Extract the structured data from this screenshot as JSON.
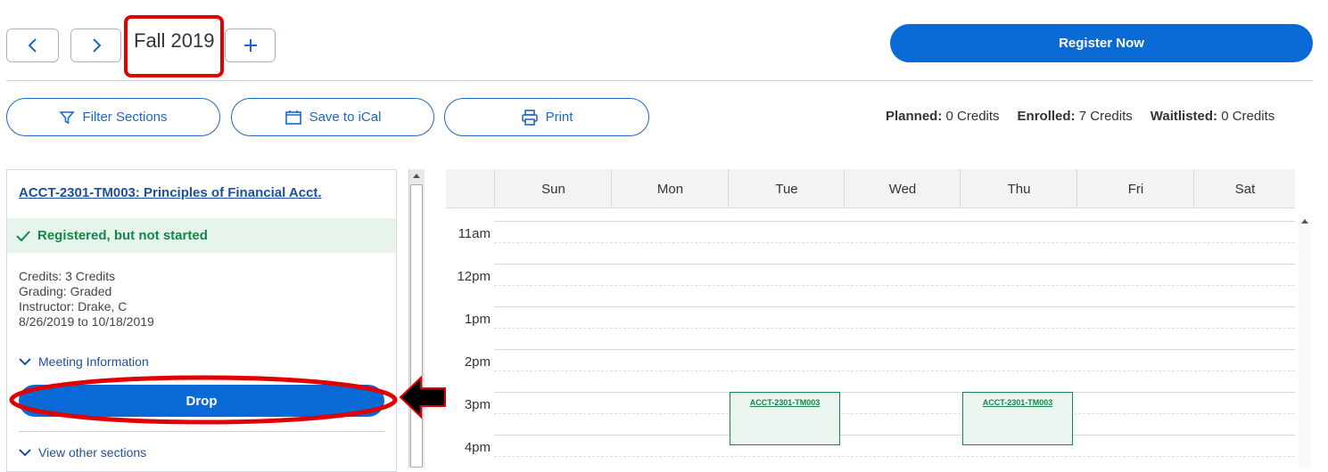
{
  "term": {
    "prev_icon": "chevron-left-icon",
    "next_icon": "chevron-right-icon",
    "label": "Fall 2019",
    "add_icon": "plus-icon"
  },
  "register": {
    "label": "Register Now"
  },
  "toolbar": {
    "filter_label": "Filter Sections",
    "ical_label": "Save to iCal",
    "print_label": "Print"
  },
  "credits": {
    "planned_label": "Planned:",
    "planned_value": "0 Credits",
    "enrolled_label": "Enrolled:",
    "enrolled_value": "7 Credits",
    "waitlisted_label": "Waitlisted:",
    "waitlisted_value": "0 Credits"
  },
  "course": {
    "title": "ACCT-2301-TM003: Principles of Financial Acct.",
    "status": "Registered, but not started",
    "credits": "Credits: 3 Credits",
    "grading": "Grading: Graded",
    "instructor": "Instructor: Drake, C",
    "dates": "8/26/2019 to 10/18/2019",
    "meeting_info": "Meeting Information",
    "drop_label": "Drop",
    "other_sections": "View other sections"
  },
  "calendar": {
    "days": [
      "Sun",
      "Mon",
      "Tue",
      "Wed",
      "Thu",
      "Fri",
      "Sat"
    ],
    "hours": [
      "11am",
      "12pm",
      "1pm",
      "2pm",
      "3pm",
      "4pm"
    ],
    "events": [
      {
        "label": "ACCT-2301-TM003",
        "day": "Tue",
        "start": "3pm"
      },
      {
        "label": "ACCT-2301-TM003",
        "day": "Thu",
        "start": "3pm"
      }
    ]
  },
  "annotation": {
    "highlight_color": "#e10000",
    "arrow_color": "#000000"
  }
}
